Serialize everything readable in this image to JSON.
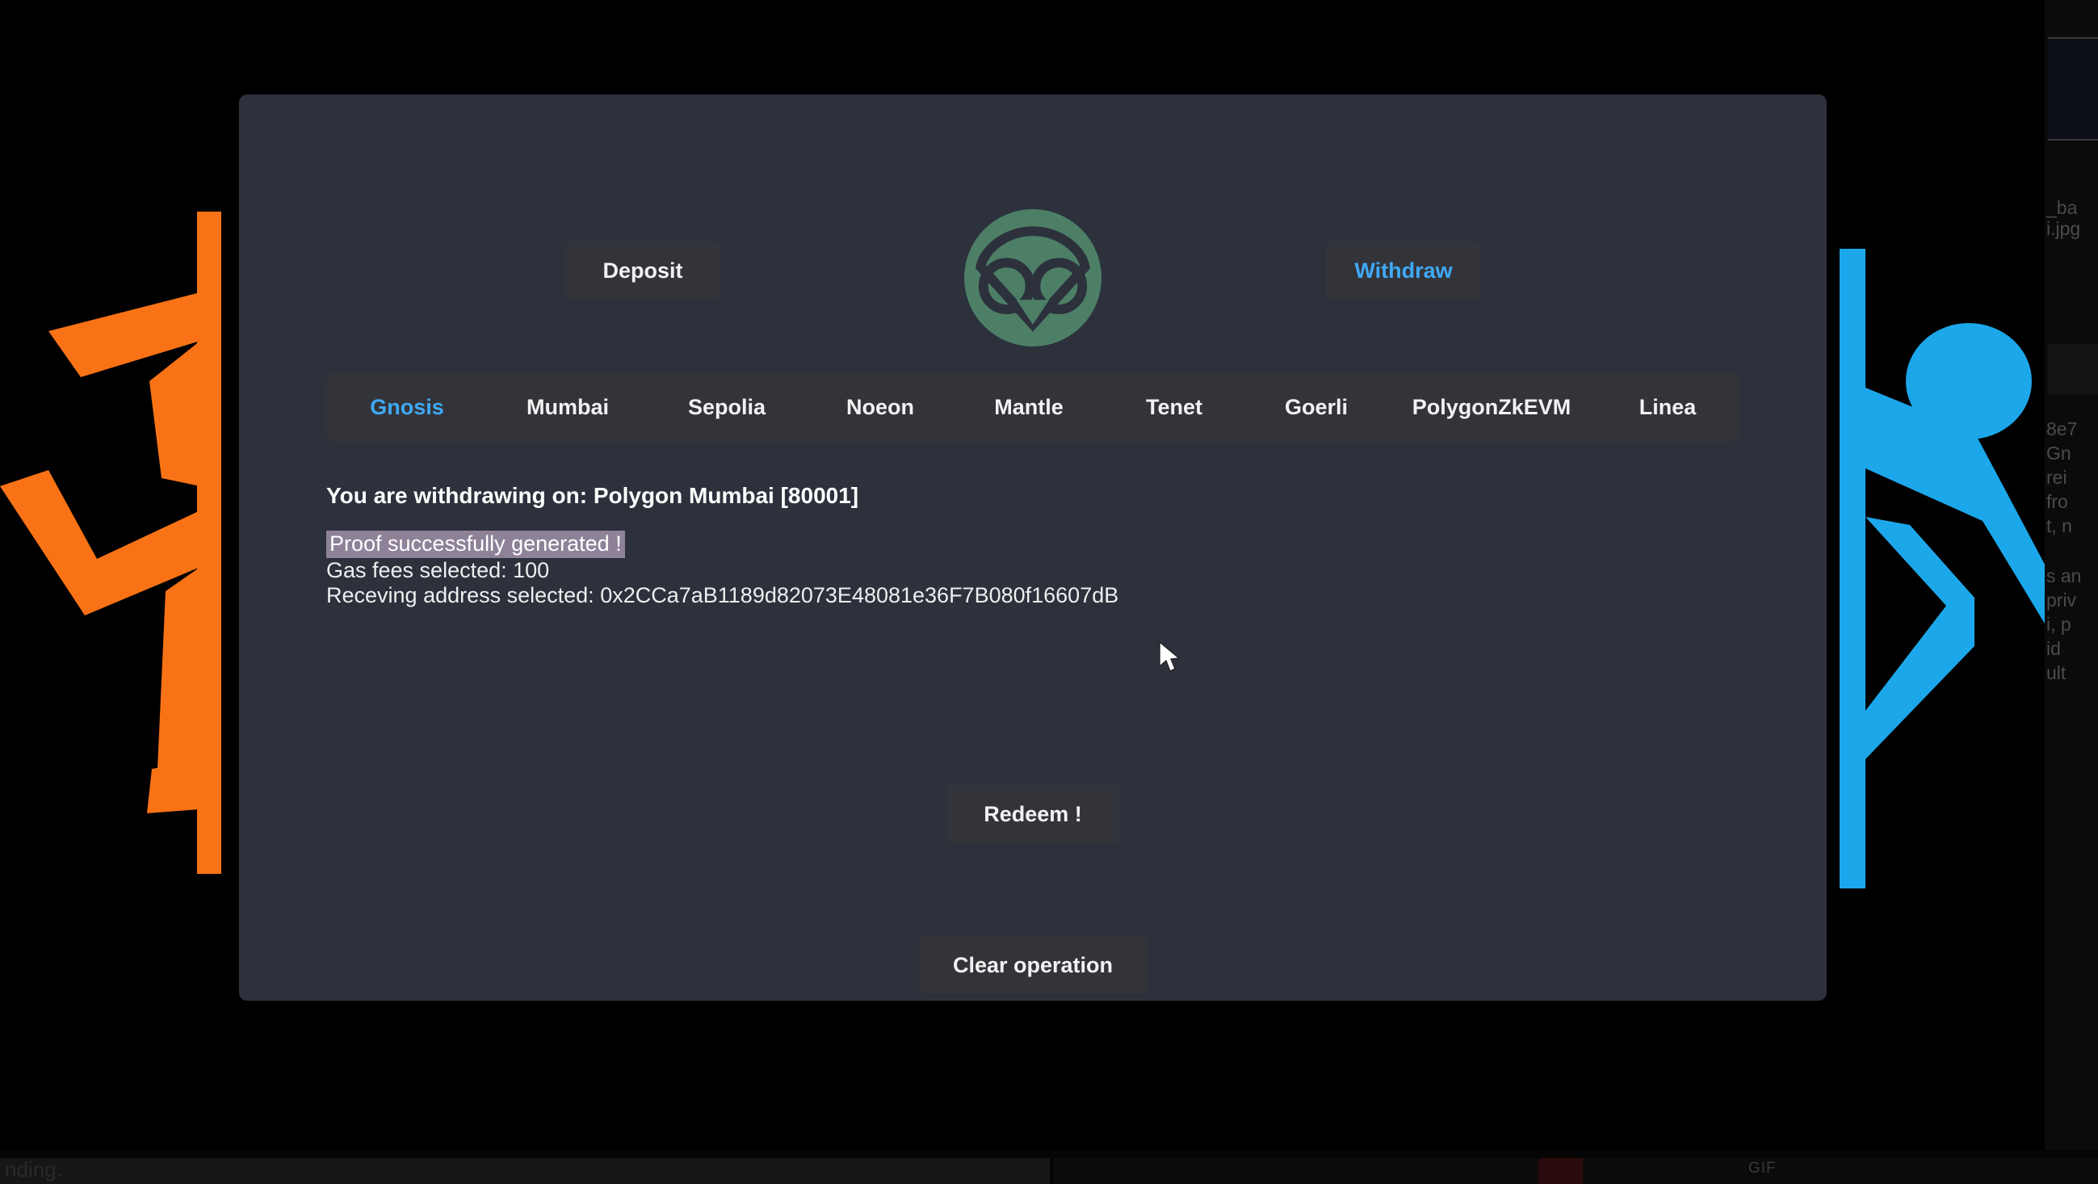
{
  "app": {
    "logo_icon": "owl-logo-icon",
    "logo_color": "#4d7f67"
  },
  "header": {
    "deposit_label": "Deposit",
    "withdraw_label": "Withdraw",
    "active_mode": "Withdraw",
    "accent_color": "#3fa9f5"
  },
  "networks": {
    "active": "Gnosis",
    "tabs": [
      {
        "label": "Gnosis",
        "active": true
      },
      {
        "label": "Mumbai",
        "active": false
      },
      {
        "label": "Sepolia",
        "active": false
      },
      {
        "label": "Noeon",
        "active": false
      },
      {
        "label": "Mantle",
        "active": false
      },
      {
        "label": "Tenet",
        "active": false
      },
      {
        "label": "Goerli",
        "active": false
      },
      {
        "label": "PolygonZkEVM",
        "active": false
      },
      {
        "label": "Linea",
        "active": false
      }
    ]
  },
  "status": {
    "headline": "You are withdrawing on: Polygon Mumbai [80001]",
    "proof_message": "Proof successfully generated !",
    "proof_highlight_color": "#8e8299",
    "gas_line": "Gas fees selected: 100",
    "address_line": "Receving address selected: 0x2CCa7aB1189d82073E48081e36F7B080f16607dB",
    "gas_fees_value": "100",
    "receiving_address": "0x2CCa7aB1189d82073E48081e36F7B080f16607dB",
    "network_name": "Polygon Mumbai",
    "chain_id": "80001"
  },
  "actions": {
    "redeem_label": "Redeem !",
    "clear_label": "Clear operation"
  },
  "background": {
    "left_figure_color": "#f97316",
    "right_figure_color": "#1ca7eb",
    "page_color": "#000000",
    "card_color": "#2c313c"
  },
  "edge_fragments": {
    "right": [
      "_ba",
      "i.jpg",
      "8e7",
      "Gn",
      "rei",
      "fro",
      "t, n",
      "s an",
      "priv",
      "i, p",
      "id",
      "ult"
    ],
    "bottom_left": "nding.",
    "bottom_gif_label": "GIF"
  }
}
